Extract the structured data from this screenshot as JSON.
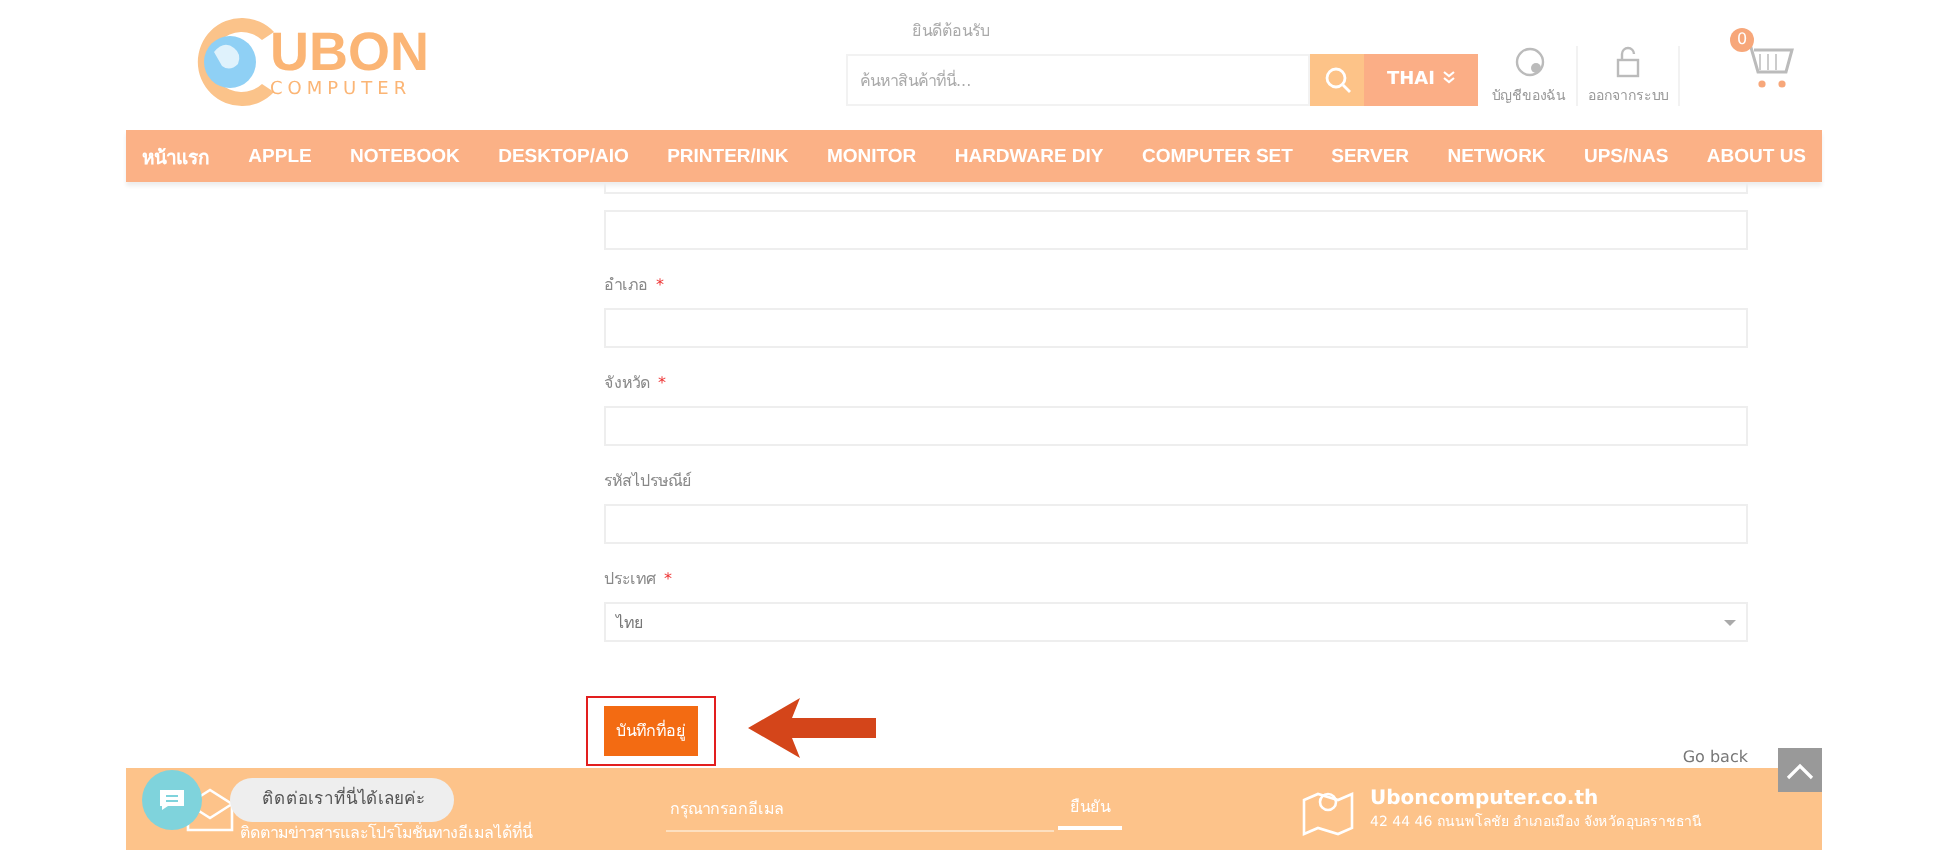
{
  "header": {
    "welcome": "ยินดีต้อนรับ",
    "logo": {
      "word": "UBON",
      "sub": "COMPUTER"
    },
    "search": {
      "placeholder": "ค้นหาสินค้าที่นี่..."
    },
    "language": "THAI",
    "account": "บัญชีของฉัน",
    "logout": "ออกจากระบบ",
    "cart_count": "0"
  },
  "nav": [
    "หน้าแรก",
    "APPLE",
    "NOTEBOOK",
    "DESKTOP/AIO",
    "PRINTER/INK",
    "MONITOR",
    "HARDWARE DIY",
    "COMPUTER SET",
    "SERVER",
    "NETWORK",
    "UPS/NAS",
    "ABOUT US"
  ],
  "form": {
    "fields": [
      {
        "kind": "input",
        "cut": true
      },
      {
        "kind": "input"
      },
      {
        "kind": "input",
        "label": "อำเภอ",
        "required": true
      },
      {
        "kind": "input",
        "label": "จังหวัด",
        "required": true
      },
      {
        "kind": "input",
        "label": "รหัสไปรษณีย์",
        "required": false
      },
      {
        "kind": "select",
        "label": "ประเทศ",
        "required": true,
        "value": "ไทย"
      }
    ],
    "required_mark": "*",
    "save": "บันทึกที่อยู่",
    "go_back": "Go back"
  },
  "footer": {
    "newsletter": "ติดตามข่าวสารและโปรโมชั่นทางอีเมลได้ที่นี่",
    "email_placeholder": "กรุณากรอกอีเมล",
    "submit": "ยืนยัน",
    "site": "Uboncomputer.co.th",
    "address": "42 44 46 ถนนพโลชัย อำเภอเมือง จังหวัดอุบลราชธานี"
  },
  "chat": {
    "bubble": "ติดต่อเราที่นี่ได้เลยค่ะ"
  }
}
